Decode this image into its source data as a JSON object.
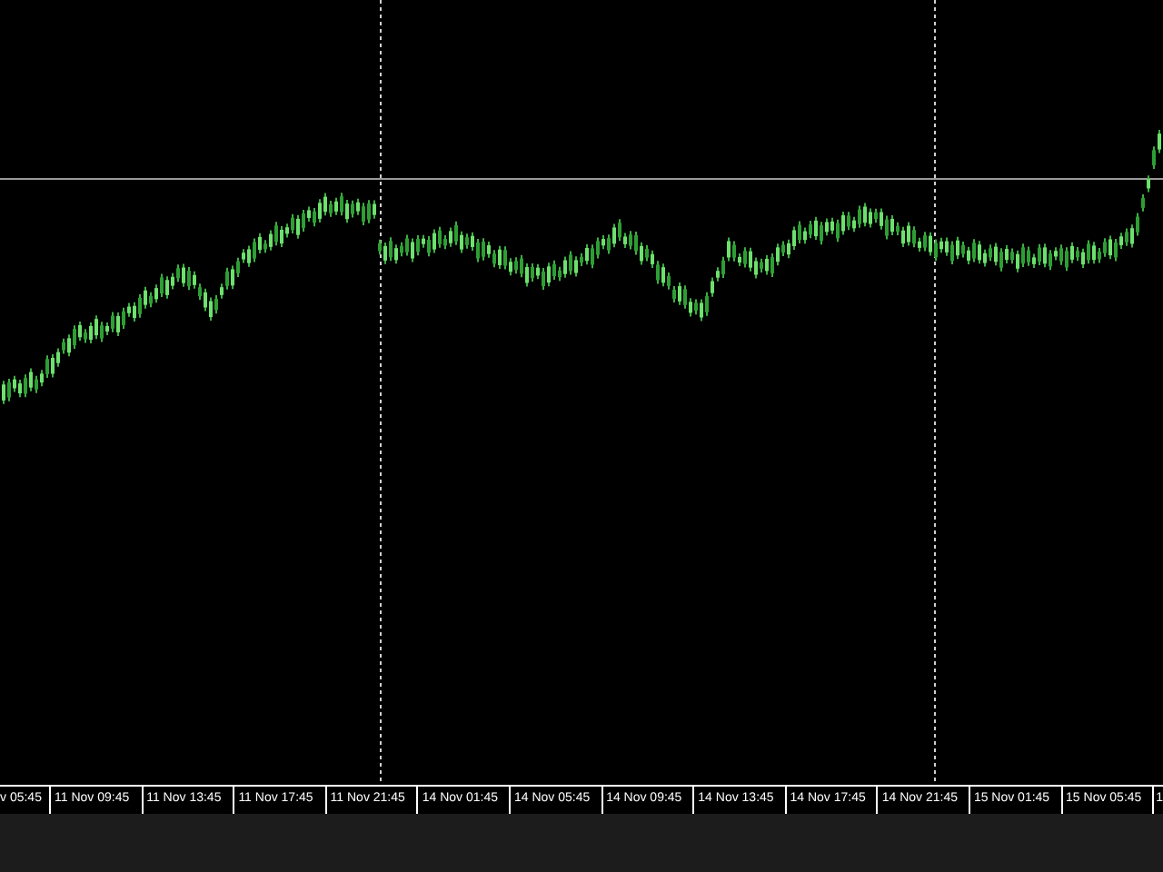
{
  "time_axis": {
    "labels": [
      "v 05:45",
      "11 Nov 09:45",
      "11 Nov 13:45",
      "11 Nov 17:45",
      "11 Nov 21:45",
      "14 Nov 01:45",
      "14 Nov 05:45",
      "14 Nov 09:45",
      "14 Nov 13:45",
      "14 Nov 17:45",
      "14 Nov 21:45",
      "15 Nov 01:45",
      "15 Nov 05:45",
      "1"
    ]
  }
}
